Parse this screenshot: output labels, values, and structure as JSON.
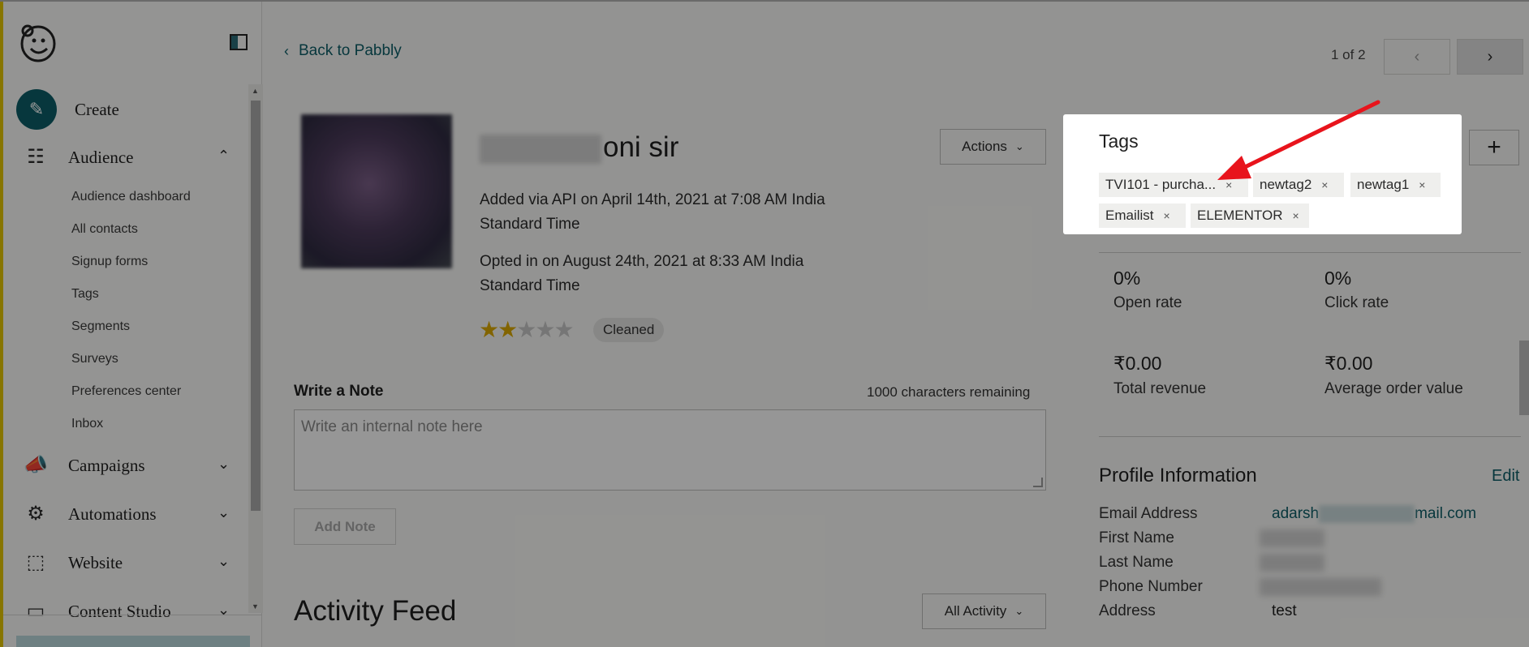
{
  "sidebar": {
    "create_label": "Create",
    "audience_label": "Audience",
    "audience_items": [
      "Audience dashboard",
      "All contacts",
      "Signup forms",
      "Tags",
      "Segments",
      "Surveys",
      "Preferences center",
      "Inbox"
    ],
    "campaigns_label": "Campaigns",
    "automations_label": "Automations",
    "website_label": "Website",
    "content_studio_label": "Content Studio"
  },
  "header": {
    "back_label": "Back to Pabbly",
    "pager": "1 of 2"
  },
  "contact": {
    "name_visible": "oni sir",
    "added_line1": "Added via API on April 14th, 2021 at 7:08 AM India",
    "added_line2": "Standard Time",
    "opted_line1": "Opted in on August 24th, 2021 at 8:33 AM India",
    "opted_line2": "Standard Time",
    "rating": 2,
    "rating_max": 5,
    "status_badge": "Cleaned",
    "actions_label": "Actions"
  },
  "note": {
    "title": "Write a Note",
    "remaining": "1000 characters remaining",
    "placeholder": "Write an internal note here",
    "add_label": "Add Note"
  },
  "activity": {
    "title": "Activity Feed",
    "filter_label": "All Activity"
  },
  "tags_popup": {
    "title": "Tags",
    "tags": [
      "TVI101 - purcha...",
      "newtag2",
      "newtag1",
      "Emailist",
      "ELEMENTOR"
    ],
    "remove_symbol": "×"
  },
  "stats": {
    "open_rate_value": "0%",
    "open_rate_label": "Open rate",
    "click_rate_value": "0%",
    "click_rate_label": "Click rate",
    "total_revenue_value": "₹0.00",
    "total_revenue_label": "Total revenue",
    "avg_order_value": "₹0.00",
    "avg_order_label": "Average order value"
  },
  "profile": {
    "title": "Profile Information",
    "edit_label": "Edit",
    "email_label": "Email Address",
    "email_prefix": "adarsh",
    "email_suffix": "mail.com",
    "first_name_label": "First Name",
    "last_name_label": "Last Name",
    "phone_label": "Phone Number",
    "address_label": "Address",
    "address_value": "test"
  },
  "colors": {
    "brand_teal": "#0d5d66",
    "star_gold": "#d9a700",
    "annotation_red": "#e8141c"
  }
}
